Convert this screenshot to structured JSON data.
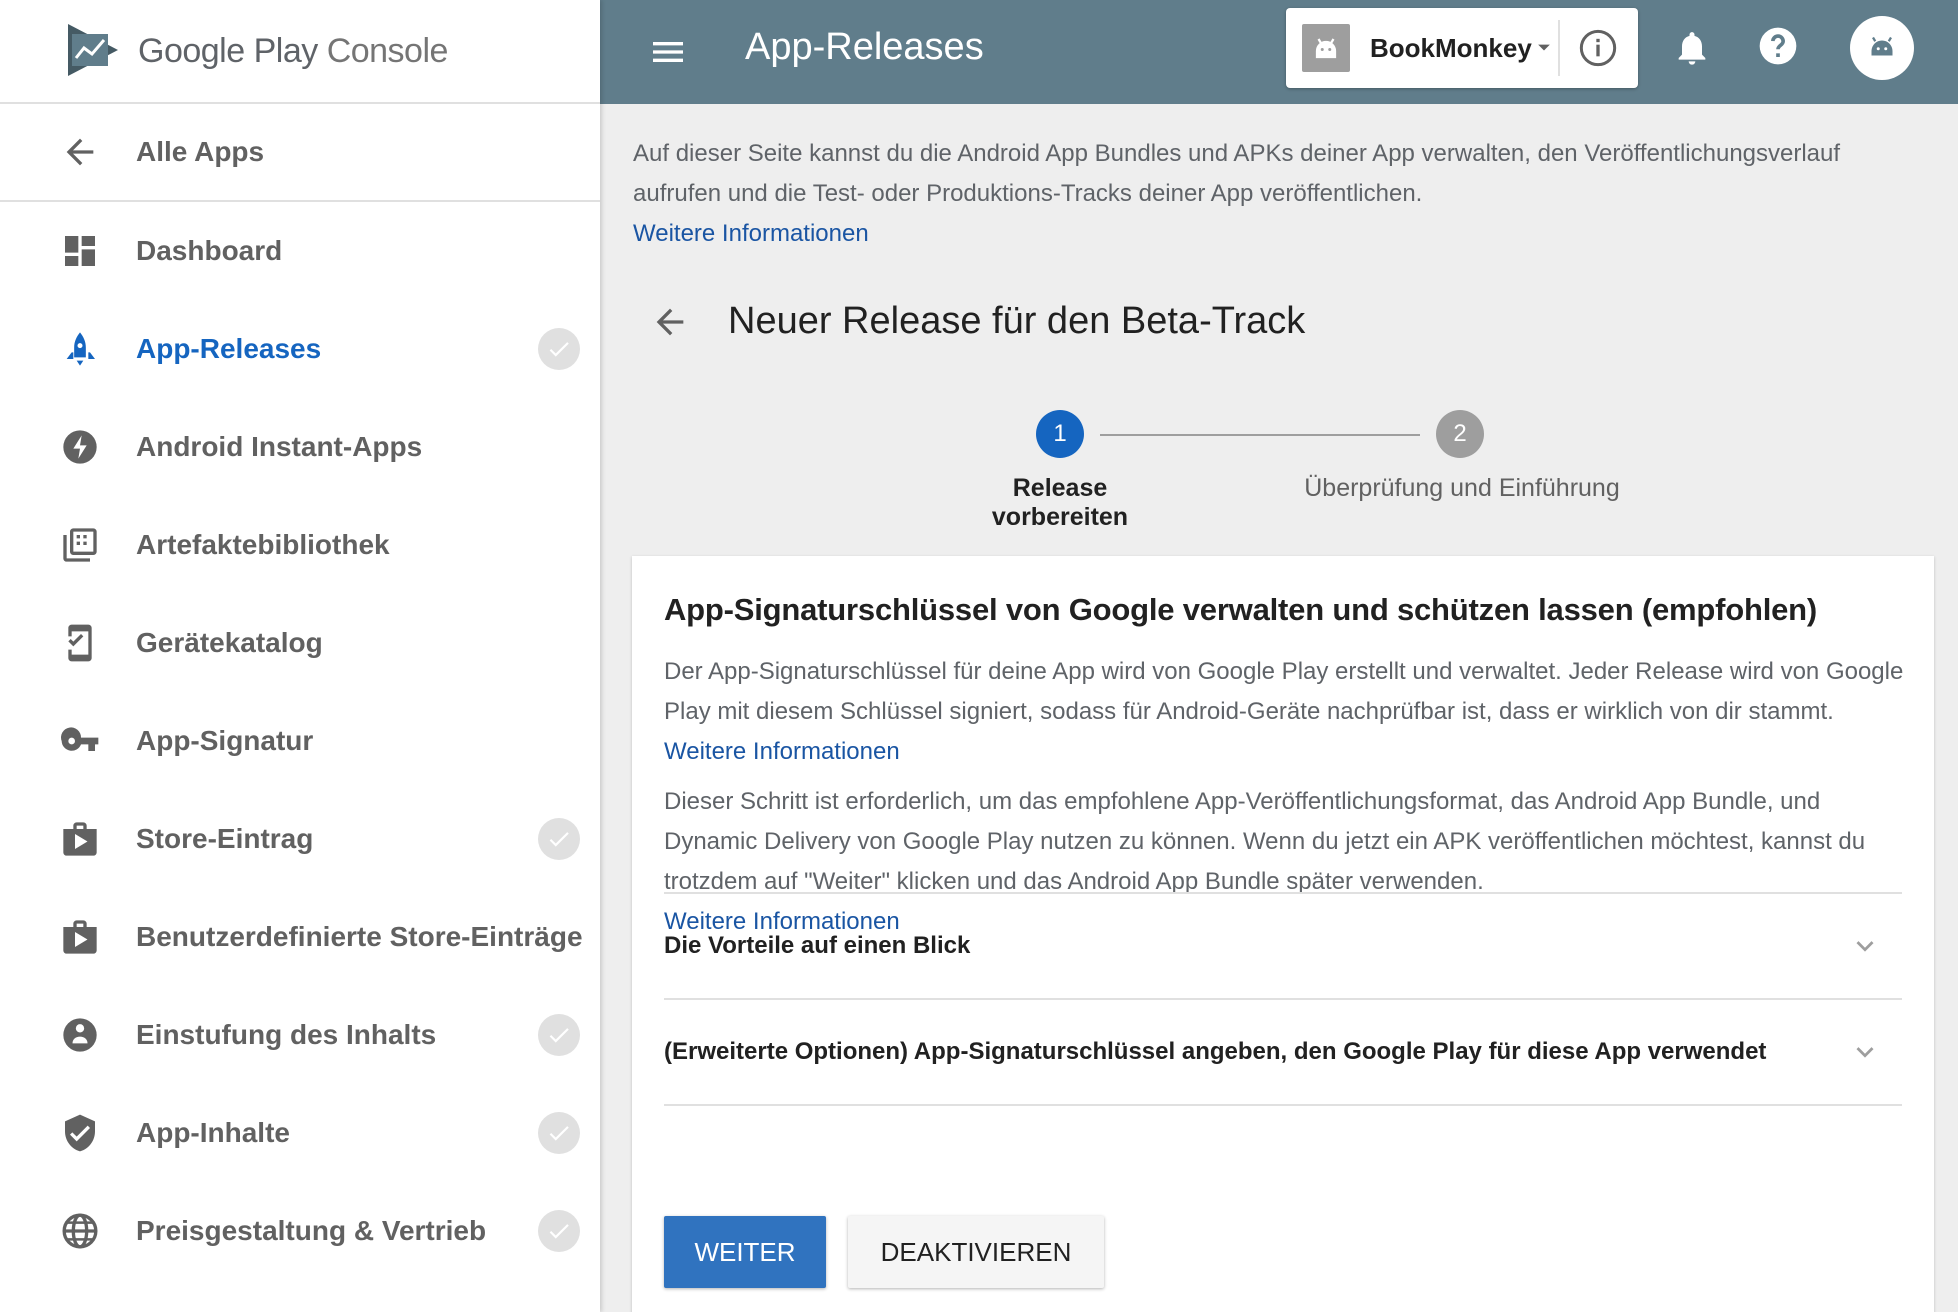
{
  "brand": {
    "google_play": "Google Play",
    "console": "Console"
  },
  "sidebar": {
    "back_label": "Alle Apps",
    "items": [
      {
        "label": "Dashboard",
        "icon": "dashboard-icon",
        "checked": false,
        "active": false
      },
      {
        "label": "App-Releases",
        "icon": "rocket-icon",
        "checked": true,
        "active": true
      },
      {
        "label": "Android Instant-Apps",
        "icon": "bolt-icon",
        "checked": false,
        "active": false
      },
      {
        "label": "Artefaktebibliothek",
        "icon": "library-icon",
        "checked": false,
        "active": false
      },
      {
        "label": "Gerätekatalog",
        "icon": "device-catalog-icon",
        "checked": false,
        "active": false
      },
      {
        "label": "App-Signatur",
        "icon": "key-icon",
        "checked": false,
        "active": false
      },
      {
        "label": "Store-Eintrag",
        "icon": "store-icon",
        "checked": true,
        "active": false
      },
      {
        "label": "Benutzerdefinierte Store-Einträge",
        "icon": "store-icon",
        "checked": false,
        "active": false
      },
      {
        "label": "Einstufung des Inhalts",
        "icon": "rating-icon",
        "checked": true,
        "active": false
      },
      {
        "label": "App-Inhalte",
        "icon": "shield-icon",
        "checked": true,
        "active": false
      },
      {
        "label": "Preisgestaltung & Vertrieb",
        "icon": "globe-icon",
        "checked": true,
        "active": false
      }
    ]
  },
  "header": {
    "title": "App-Releases",
    "app_name": "BookMonkey"
  },
  "main": {
    "intro_text": "Auf dieser Seite kannst du die Android App Bundles und APKs deiner App verwalten, den Veröffentlichungsverlauf aufrufen und die Test- oder Produktions-Tracks deiner App veröffentlichen.",
    "intro_link": "Weitere Informationen",
    "release_title": "Neuer Release für den Beta-Track",
    "steps": [
      {
        "number": "1",
        "label": "Release vorbereiten"
      },
      {
        "number": "2",
        "label": "Überprüfung und Einführung"
      }
    ],
    "card": {
      "title": "App-Signaturschlüssel von Google verwalten und schützen lassen (empfohlen)",
      "p1_text": "Der App-Signaturschlüssel für deine App wird von Google Play erstellt und verwaltet. Jeder Release wird von Google Play mit diesem Schlüssel signiert, sodass für Android-Geräte nachprüfbar ist, dass er wirklich von dir stammt.",
      "p1_link": "Weitere Informationen",
      "p2_text": "Dieser Schritt ist erforderlich, um das empfohlene App-Veröffentlichungsformat, das Android App Bundle, und Dynamic Delivery von Google Play nutzen zu können. Wenn du jetzt ein APK veröffentlichen möchtest, kannst du trotzdem auf \"Weiter\" klicken und das Android App Bundle später verwenden.",
      "p2_link": "Weitere Informationen",
      "accordion_1": "Die Vorteile auf einen Blick",
      "accordion_2": "(Erweiterte Optionen) App-Signaturschlüssel angeben, den Google Play für diese App verwendet",
      "primary_button": "WEITER",
      "secondary_button": "DEAKTIVIEREN"
    }
  },
  "colors": {
    "header_bg": "#607d8b",
    "accent": "#1565c0",
    "link": "#1a55a3",
    "primary_button": "#3073bf"
  }
}
